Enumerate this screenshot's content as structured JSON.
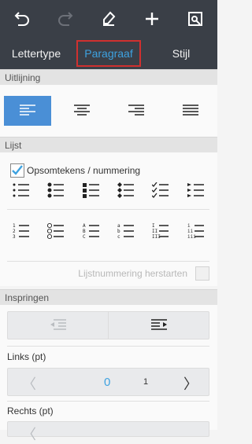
{
  "toolbar": {
    "items": [
      "undo-icon",
      "redo-icon",
      "format-clear-icon",
      "add-icon",
      "save-icon"
    ]
  },
  "tabs": [
    {
      "label": "Lettertype"
    },
    {
      "label": "Paragraaf"
    },
    {
      "label": "Stijl"
    }
  ],
  "sections": {
    "alignment": "Uitlijning",
    "list": "Lijst",
    "indent": "Inspringen"
  },
  "list": {
    "checkbox_label": "Opsomtekens / nummering",
    "checkbox_checked": true,
    "restart_label": "Lijstnummering herstarten"
  },
  "indent": {
    "left_label": "Links (pt)",
    "left_value": "0",
    "left_step": "1",
    "right_label": "Rechts (pt)"
  },
  "colors": {
    "toolbar_bg": "#3a3f47",
    "accent": "#3ea2e0",
    "active_align": "#4a8fd6",
    "highlight_border": "#d0302f"
  }
}
